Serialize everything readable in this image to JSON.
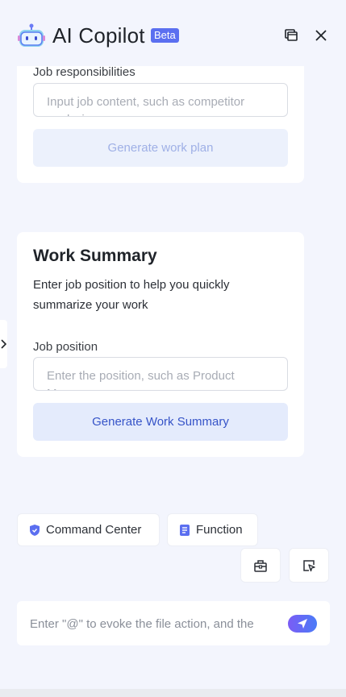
{
  "header": {
    "title": "AI Copilot",
    "badge": "Beta"
  },
  "cards": {
    "work_plan": {
      "field_label": "Job responsibilities",
      "field_text": "Input job content, such as competitor analysis",
      "button": "Generate work plan"
    },
    "work_summary": {
      "title": "Work Summary",
      "description": "Enter job position to help you quickly summarize your work",
      "field_label": "Job position",
      "field_text": "Enter the position, such as Product Manager",
      "button": "Generate Work Summary"
    }
  },
  "chips": {
    "command_center": "Command Center",
    "function": "Function"
  },
  "composer": {
    "placeholder": "Enter \"@\" to evoke the file action, and the"
  },
  "colors": {
    "accent": "#5b6ff0",
    "send_gradient_start": "#7b5cf5",
    "send_gradient_end": "#4a7bf7"
  }
}
